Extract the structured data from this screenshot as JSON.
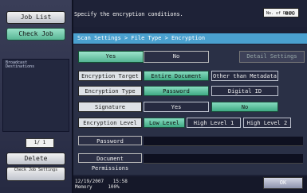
{
  "sidebar": {
    "job_list": "Job List",
    "check_job": "Check Job",
    "broadcast_destinations": "Broadcast Destinations",
    "counter": "1/  1",
    "delete": "Delete",
    "check_job_settings": "Check Job Settings"
  },
  "header": {
    "message": "Specify the encryption conditions.",
    "badge_label": "No. of Dest.",
    "badge_value": "000"
  },
  "breadcrumb": "Scan Settings > File Type > Encryption",
  "encryption_toggle": {
    "yes": "Yes",
    "no": "No",
    "detail_settings": "Detail Settings"
  },
  "rows": {
    "target_label": "Encryption Target",
    "target_opt1": "Entire Document",
    "target_opt2": "Other than Metadata",
    "type_label": "Encryption Type",
    "type_opt1": "Password",
    "type_opt2": "Digital ID",
    "sig_label": "Signature",
    "sig_yes": "Yes",
    "sig_no": "No",
    "level_label": "Encryption Level",
    "level_low": "Low Level",
    "level_high1": "High Level 1",
    "level_high2": "High Level 2",
    "password": "Password",
    "doc_permissions": "Document Permissions"
  },
  "footer": {
    "date": "12/19/2007",
    "time": "15:58",
    "memory_label": "Memory",
    "memory_value": "100%",
    "ok": "OK"
  }
}
